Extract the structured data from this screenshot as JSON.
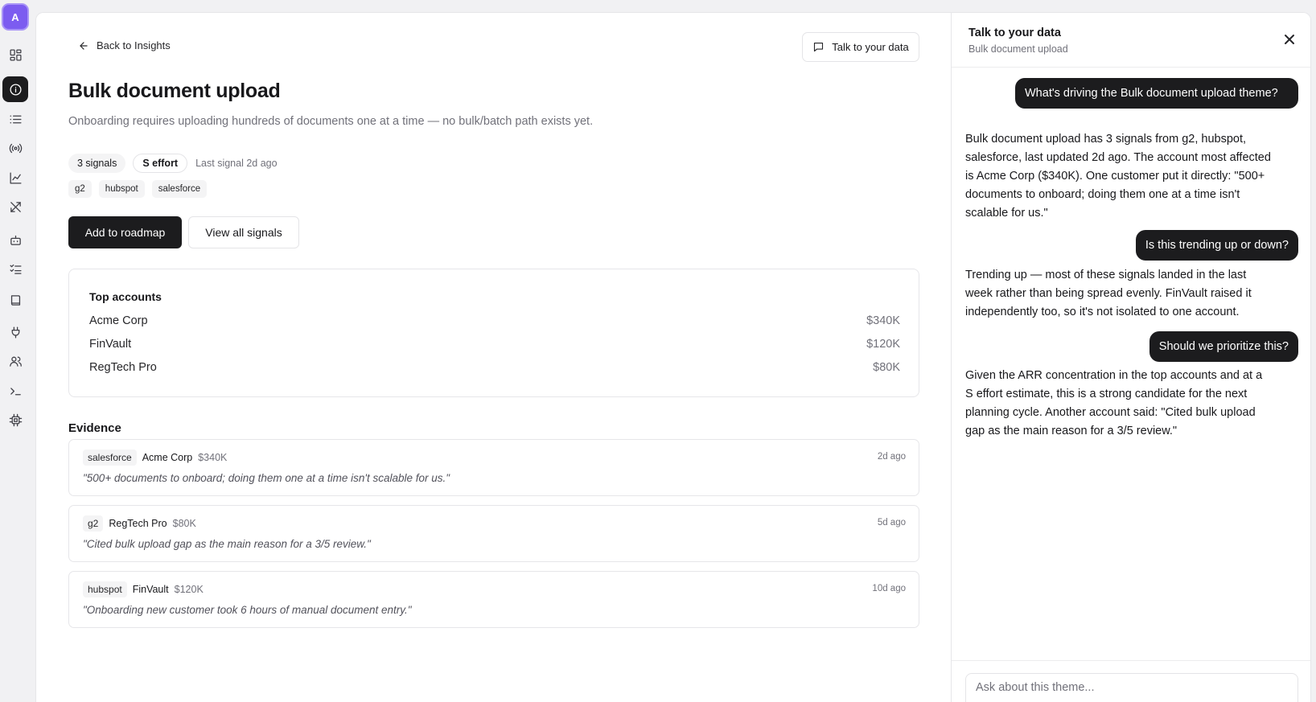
{
  "rail": {
    "avatar_initial": "A",
    "items": [
      {
        "icon": "grid-icon"
      },
      {
        "icon": "info-icon",
        "active": true
      },
      {
        "icon": "list-icon"
      },
      {
        "icon": "signal-icon"
      },
      {
        "icon": "chart-line-icon"
      },
      {
        "icon": "tools-icon"
      },
      {
        "icon": "bot-icon"
      },
      {
        "icon": "checklist-icon"
      },
      {
        "icon": "book-icon"
      },
      {
        "icon": "plug-icon"
      },
      {
        "icon": "users-icon"
      },
      {
        "icon": "terminal-icon"
      },
      {
        "icon": "chip-icon"
      }
    ]
  },
  "header": {
    "back_label": "Back to Insights",
    "talk_button_label": "Talk to your data"
  },
  "theme": {
    "title": "Bulk document upload",
    "description": "Onboarding requires uploading hundreds of documents one at a time — no bulk/batch path exists yet.",
    "signals_chip": "3 signals",
    "effort_chip": "S effort",
    "last_signal": "Last signal 2d ago",
    "sources": [
      "g2",
      "hubspot",
      "salesforce"
    ]
  },
  "actions": {
    "add_to_roadmap": "Add to roadmap",
    "view_all_signals": "View all signals"
  },
  "top_accounts": {
    "title": "Top accounts",
    "rows": [
      {
        "name": "Acme Corp",
        "value": "$340K"
      },
      {
        "name": "FinVault",
        "value": "$120K"
      },
      {
        "name": "RegTech Pro",
        "value": "$80K"
      }
    ]
  },
  "evidence": {
    "title": "Evidence",
    "items": [
      {
        "source": "salesforce",
        "account": "Acme Corp",
        "arr": "$340K",
        "time": "2d ago",
        "quote": "\"500+ documents to onboard; doing them one at a time isn't scalable for us.\""
      },
      {
        "source": "g2",
        "account": "RegTech Pro",
        "arr": "$80K",
        "time": "5d ago",
        "quote": "\"Cited bulk upload gap as the main reason for a 3/5 review.\""
      },
      {
        "source": "hubspot",
        "account": "FinVault",
        "arr": "$120K",
        "time": "10d ago",
        "quote": "\"Onboarding new customer took 6 hours of manual document entry.\""
      }
    ]
  },
  "chat": {
    "title": "Talk to your data",
    "subtitle": "Bulk document upload",
    "messages": [
      {
        "role": "user",
        "text": "What's driving the Bulk document upload theme?"
      },
      {
        "role": "assistant",
        "text": "Bulk document upload has 3 signals from g2, hubspot, salesforce, last updated 2d ago. The account most affected is Acme Corp ($340K). One customer put it directly: \"500+ documents to onboard; doing them one at a time isn't scalable for us.\""
      },
      {
        "role": "user",
        "text": "Is this trending up or down?"
      },
      {
        "role": "assistant",
        "text": "Trending up — most of these signals landed in the last week rather than being spread evenly. FinVault raised it independently too, so it's not isolated to one account."
      },
      {
        "role": "user",
        "text": "Should we prioritize this?"
      },
      {
        "role": "assistant",
        "text": "Given the ARR concentration in the top accounts and at a S effort estimate, this is a strong candidate for the next planning cycle. Another account said: \"Cited bulk upload gap as the main reason for a 3/5 review.\""
      }
    ],
    "input_placeholder": "Ask about this theme..."
  }
}
